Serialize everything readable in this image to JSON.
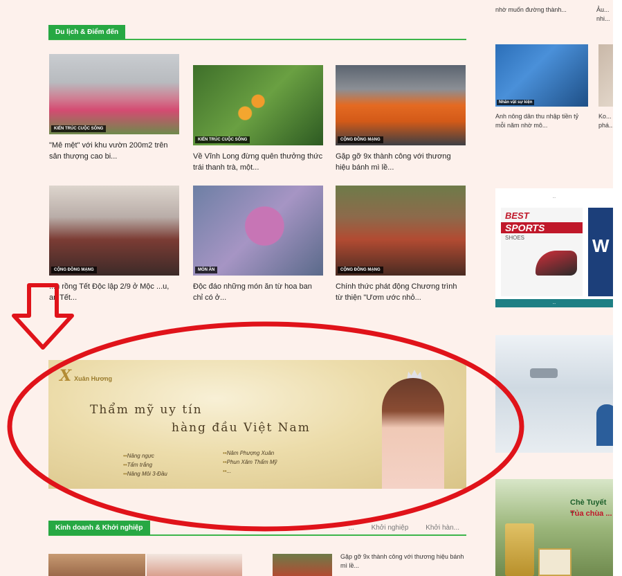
{
  "colors": {
    "accent": "#27a843",
    "annotation": "#e0131a"
  },
  "top_sidebar": {
    "snippet1": "nhờ muốn đường thành...",
    "snippet2": "Ảu... nhi..."
  },
  "travel_section": {
    "label": "Du lịch & Điểm đến",
    "articles": [
      {
        "badge": "Kiến trúc cuộc sống",
        "title": "\"Mê mệt\" với khu vườn 200m2 trên sân thượng cao bi..."
      },
      {
        "badge": "Kiến trúc cuộc sống",
        "title": "Về Vĩnh Long đừng quên thưởng thức trái thanh trà, một..."
      },
      {
        "badge": "Cộng đồng mạng",
        "title": "Gặp gỡ 9x thành công với thương hiệu bánh mì lề..."
      },
      {
        "badge": "Cộng đồng mạng",
        "title": "...n rồng Tết Độc lập 2/9 ở Mộc ...u, an Tết..."
      },
      {
        "badge": "Món ăn",
        "title": "Độc đáo những món ăn từ hoa ban chỉ có ở..."
      },
      {
        "badge": "Cộng đồng mạng",
        "title": "Chính thức phát động Chương trình từ thiện \"Ươm ước nhỏ..."
      }
    ]
  },
  "sidebar": {
    "video": {
      "badge": "Nhân vật sự kiện",
      "title": "Anh nông dân thu nhập tiền tỷ mỗi năm nhờ mô..."
    },
    "video2": {
      "title": "Ko... phá..."
    },
    "ad1": {
      "top": "...",
      "best": "BEST",
      "sports": "SPORTS",
      "shoes": "SHOES",
      "right": "W",
      "footer": "..."
    },
    "ad3": {
      "headline": "Chè Tuyết ...",
      "sub": "Tủa chùa ..."
    }
  },
  "banner": {
    "brand": "Xuân Hương",
    "mark": "X",
    "headline_line1": "Thẩm mỹ uy tín",
    "headline_line2": "hàng đầu Việt Nam",
    "services_left": [
      "Nâng ngực",
      "Tẩm trắng",
      "Nâng Môi 3-Đầu"
    ],
    "services_right": [
      "Nâm Phượng Xuân",
      "Phun Xăm Thẩm Mỹ",
      "..."
    ]
  },
  "business_section": {
    "label": "Kinh doanh & Khởi nghiệp",
    "subnav": [
      "...",
      "Khởi nghiệp",
      "Khởi hàn..."
    ],
    "article_side": "Gặp gỡ 9x thành công với thương hiệu bánh mì lề..."
  }
}
